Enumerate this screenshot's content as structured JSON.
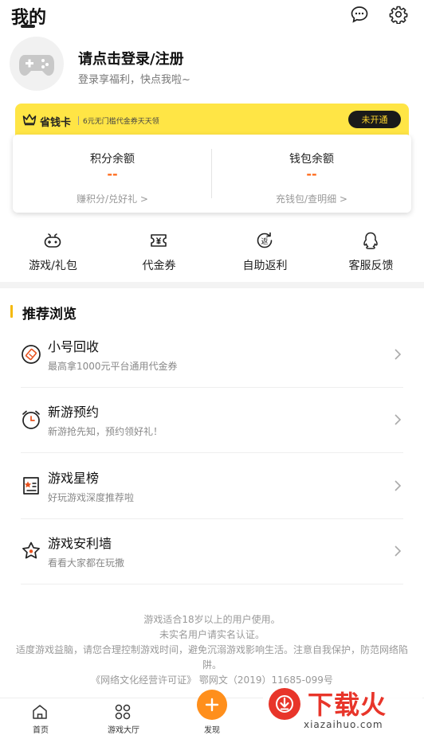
{
  "header": {
    "title": "我的",
    "icons": [
      "message-icon",
      "gear-icon"
    ]
  },
  "profile": {
    "title": "请点击登录/注册",
    "subtitle": "登录享福利，快点我啦~"
  },
  "saver_card": {
    "title": "省钱卡",
    "desc": "6元无门槛代金券天天领",
    "button": "未开通",
    "colors": {
      "bar": "#ffe545",
      "button_bg": "#1a1a1a",
      "button_text": "#ffd72c"
    }
  },
  "balance": {
    "points": {
      "label": "积分余额",
      "value": "--",
      "link": "赚积分/兑好礼 >"
    },
    "wallet": {
      "label": "钱包余额",
      "value": "--",
      "link": "充钱包/查明细 >"
    },
    "value_color": "#ff6a1a"
  },
  "quick": [
    {
      "label": "游戏/礼包",
      "icon": "gamepad-icon"
    },
    {
      "label": "代金券",
      "icon": "voucher-icon"
    },
    {
      "label": "自助返利",
      "icon": "rebate-icon"
    },
    {
      "label": "客服反馈",
      "icon": "qq-icon"
    }
  ],
  "recommend": {
    "title": "推荐浏览",
    "items": [
      {
        "title": "小号回收",
        "subtitle": "最高拿1000元平台通用代金券",
        "icon": "recycle-icon"
      },
      {
        "title": "新游预约",
        "subtitle": "新游抢先知，预约领好礼！",
        "icon": "alarm-clock-icon"
      },
      {
        "title": "游戏星榜",
        "subtitle": "好玩游戏深度推荐啦",
        "icon": "star-list-icon"
      },
      {
        "title": "游戏安利墙",
        "subtitle": "看看大家都在玩撒",
        "icon": "star-badge-icon"
      }
    ]
  },
  "footer": {
    "line1": "游戏适合18岁以上的用户使用。",
    "line2": "未实名用户请实名认证。",
    "line3": "适度游戏益脑，请您合理控制游戏时间，避免沉溺游戏影响生活。注意自我保护，防范网络陷阱。",
    "line4": "《网络文化经营许可证》 鄂网文（2019）11685-099号"
  },
  "tabs": [
    {
      "label": "首页",
      "icon": "home-icon"
    },
    {
      "label": "游戏大厅",
      "icon": "grid-icon"
    },
    {
      "label": "发现",
      "icon": "plus-icon"
    }
  ],
  "watermark": {
    "text": "下载火",
    "url": "xiazaihuo.com"
  }
}
